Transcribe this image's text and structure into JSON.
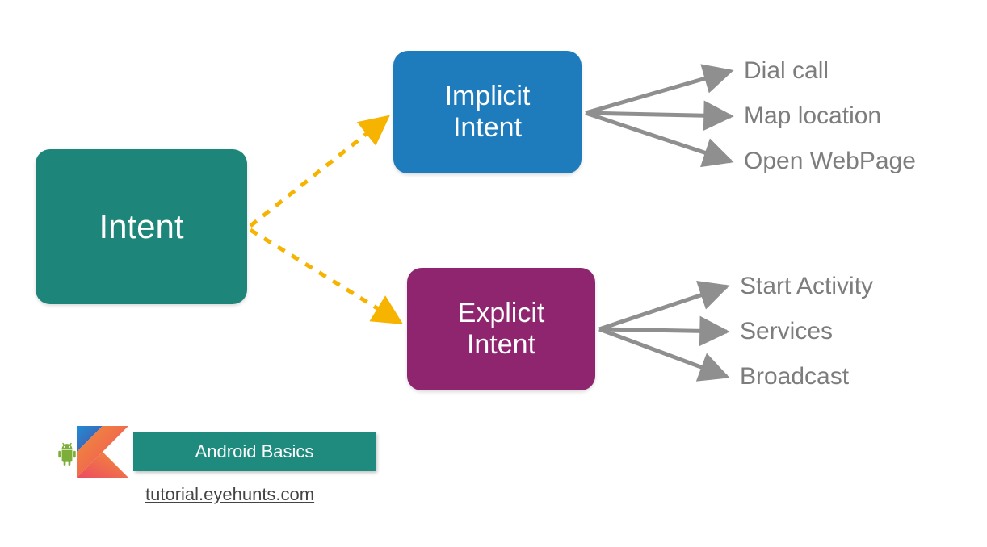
{
  "root": {
    "label": "Intent"
  },
  "implicit": {
    "label": "Implicit\nIntent",
    "leaves": [
      "Dial call",
      "Map location",
      "Open WebPage"
    ]
  },
  "explicit": {
    "label": "Explicit\nIntent",
    "leaves": [
      "Start Activity",
      "Services",
      "Broadcast"
    ]
  },
  "footer": {
    "badge": "Android Basics",
    "link": "tutorial.eyehunts.com"
  },
  "colors": {
    "root": "#1d8579",
    "implicit": "#1f7cbc",
    "explicit": "#8f256e",
    "arrow_gray": "#8f8f8f",
    "arrow_yellow": "#f6b400",
    "leaf_text": "#7d7d7d"
  },
  "chart_data": {
    "type": "tree",
    "title": "Intent types in Android",
    "nodes": [
      {
        "id": "intent",
        "label": "Intent"
      },
      {
        "id": "implicit",
        "label": "Implicit Intent",
        "parent": "intent"
      },
      {
        "id": "explicit",
        "label": "Explicit Intent",
        "parent": "intent"
      },
      {
        "id": "dial",
        "label": "Dial call",
        "parent": "implicit"
      },
      {
        "id": "map",
        "label": "Map location",
        "parent": "implicit"
      },
      {
        "id": "web",
        "label": "Open WebPage",
        "parent": "implicit"
      },
      {
        "id": "activity",
        "label": "Start Activity",
        "parent": "explicit"
      },
      {
        "id": "services",
        "label": "Services",
        "parent": "explicit"
      },
      {
        "id": "broadcast",
        "label": "Broadcast",
        "parent": "explicit"
      }
    ]
  }
}
